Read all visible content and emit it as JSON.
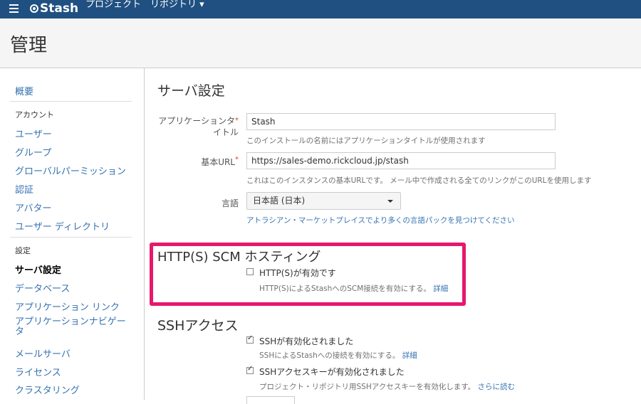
{
  "topbar": {
    "brand": "Stash",
    "nav": [
      "プロジェクト",
      "リポジトリ ▾"
    ]
  },
  "page": {
    "title": "管理"
  },
  "sidebar": {
    "overview": "概要",
    "account_heading": "アカウント",
    "account_items": [
      "ユーザー",
      "グループ",
      "グローバルパーミッション",
      "認証",
      "アバター",
      "ユーザー ディレクトリ"
    ],
    "settings_heading": "設定",
    "settings_active": "サーバ設定",
    "settings_items": [
      "データベース",
      "アプリケーション リンク",
      "アプリケーションナビゲータ",
      "メールサーバ",
      "ライセンス",
      "クラスタリング"
    ]
  },
  "server": {
    "title": "サーバ設定",
    "app_title_label_1": "アプリケーションタ",
    "app_title_label_2": "イトル",
    "app_title_value": "Stash",
    "app_title_desc": "このインストールの名前にはアプリケーションタイトルが使用されます",
    "base_url_label": "基本URL",
    "base_url_value": "https://sales-demo.rickcloud.jp/stash",
    "base_url_desc": "これはこのインスタンスの基本URLです。 メール中で作成される全てのリンクがこのURLを使用します",
    "language_label": "言語",
    "language_value": "日本語 (日本)",
    "language_link": "アトラシアン・マーケットプレイスでより多くの言語パックを見つけてください"
  },
  "http": {
    "title": "HTTP(S) SCM ホスティング",
    "checkbox_label": "HTTP(S)が有効です",
    "checked": false,
    "desc": "HTTP(S)によるStashへのSCM接続を有効にする。",
    "more": "詳細"
  },
  "ssh": {
    "title": "SSHアクセス",
    "enabled_label": "SSHが有効化されました",
    "enabled_desc": "SSHによるStashへの接続を有効にする。",
    "enabled_more": "詳細",
    "keys_label": "SSHアクセスキーが有効化されました",
    "keys_desc": "プロジェクト・リポジトリ用SSHアクセスキーを有効化します。",
    "keys_more": "さらに読む"
  },
  "colors": {
    "header": "#205081",
    "link": "#3572b0",
    "highlight": "#e6186e"
  }
}
